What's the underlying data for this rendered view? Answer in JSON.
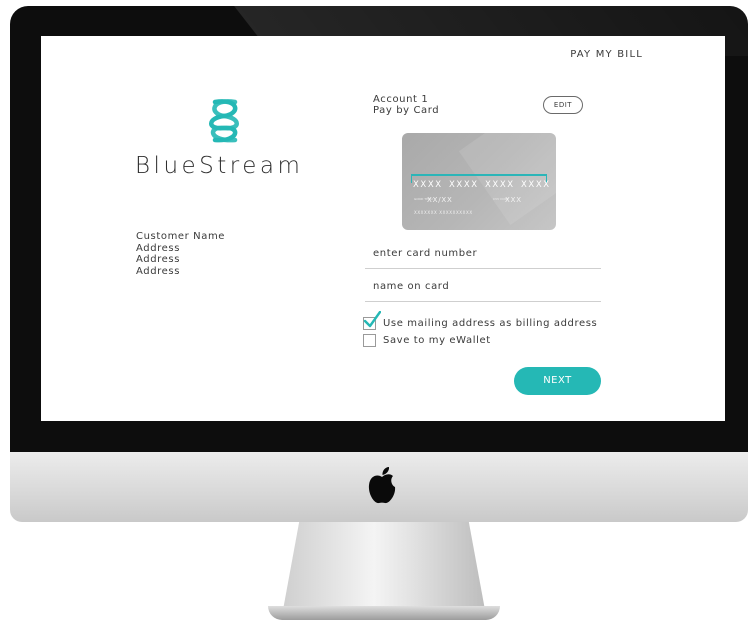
{
  "header": {
    "title": "PAY MY BILL"
  },
  "brand": {
    "name": "BlueStream",
    "logo_icon": "bluestream-wave-logo",
    "accent_color": "#25b8b5"
  },
  "customer": {
    "name": "Customer Name",
    "address_lines": [
      "Address",
      "Address",
      "Address"
    ]
  },
  "account": {
    "line1": "Account 1",
    "line2": "Pay by Card",
    "edit_label": "EDIT"
  },
  "card_preview": {
    "number": "XXXX XXXX XXXX XXXX",
    "expiry_label": "GOOD THRU",
    "expiry": "XX/XX",
    "cvv_label": "CVV CODE",
    "cvv": "XXX",
    "holder": "XXXXXXX XXXXXXXXXX"
  },
  "form": {
    "card_number_placeholder": "enter card number",
    "name_placeholder": "name on card",
    "options": [
      {
        "label": "Use mailing address as billing address",
        "checked": true
      },
      {
        "label": "Save to my eWallet",
        "checked": false
      }
    ],
    "next_label": "NEXT"
  },
  "device": {
    "logo_icon": "apple-icon"
  }
}
